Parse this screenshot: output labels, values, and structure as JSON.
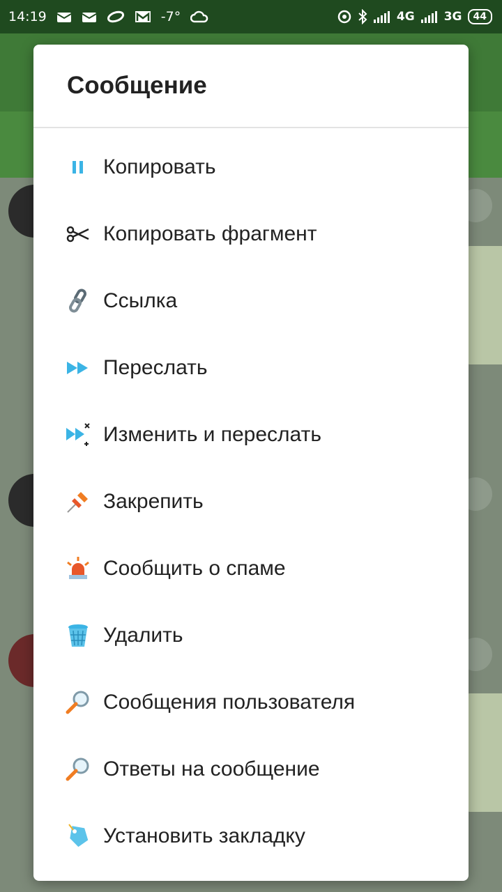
{
  "status_bar": {
    "time": "14:19",
    "temperature": "-7°",
    "network_1": "4G",
    "network_2": "3G",
    "battery": "44"
  },
  "dialog": {
    "title": "Сообщение",
    "items": [
      {
        "label": "Копировать",
        "icon": "copy-icon"
      },
      {
        "label": "Копировать фрагмент",
        "icon": "scissors-icon"
      },
      {
        "label": "Ссылка",
        "icon": "link-icon"
      },
      {
        "label": "Переслать",
        "icon": "forward-icon"
      },
      {
        "label": "Изменить и переслать",
        "icon": "edit-forward-icon"
      },
      {
        "label": "Закрепить",
        "icon": "pin-icon"
      },
      {
        "label": "Сообщить о спаме",
        "icon": "siren-icon"
      },
      {
        "label": "Удалить",
        "icon": "trash-icon"
      },
      {
        "label": "Сообщения пользователя",
        "icon": "search-icon"
      },
      {
        "label": "Ответы на сообщение",
        "icon": "search-icon"
      },
      {
        "label": "Установить закладку",
        "icon": "bookmark-tag-icon"
      }
    ]
  },
  "colors": {
    "accent_blue": "#3bb4e5",
    "status_bar": "#1f4a1f",
    "app_green": "#3f7a37",
    "orange": "#f07d22"
  }
}
